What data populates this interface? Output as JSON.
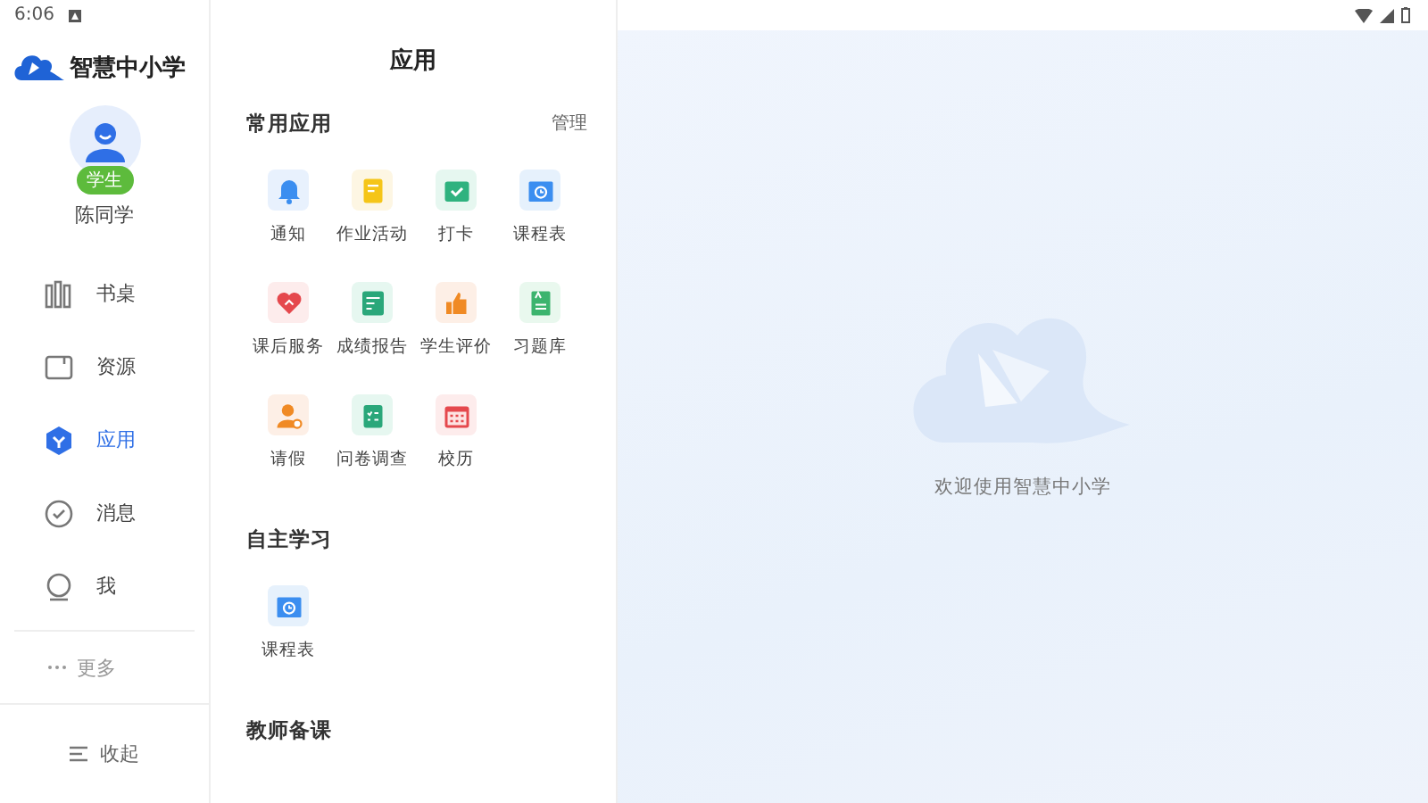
{
  "status_bar": {
    "time": "6:06"
  },
  "sidebar": {
    "logo": "智慧中小学",
    "user": {
      "role": "学生",
      "name": "陈同学"
    },
    "items": [
      {
        "kind": "desk",
        "label": "书桌",
        "selected": false
      },
      {
        "kind": "resource",
        "label": "资源",
        "selected": false
      },
      {
        "kind": "apps",
        "label": "应用",
        "selected": true
      },
      {
        "kind": "message",
        "label": "消息",
        "selected": false
      },
      {
        "kind": "me",
        "label": "我",
        "selected": false
      }
    ],
    "more": "更多",
    "collapse": "收起"
  },
  "panel": {
    "title": "应用",
    "sections": [
      {
        "title": "常用应用",
        "action": "管理",
        "apps": [
          {
            "kind": "bell",
            "label": "通知"
          },
          {
            "kind": "note",
            "label": "作业活动"
          },
          {
            "kind": "check",
            "label": "打卡"
          },
          {
            "kind": "timetable",
            "label": "课程表"
          },
          {
            "kind": "heart",
            "label": "课后服务"
          },
          {
            "kind": "score",
            "label": "成绩报告"
          },
          {
            "kind": "thumb",
            "label": "学生评价"
          },
          {
            "kind": "exercise",
            "label": "习题库"
          },
          {
            "kind": "leave",
            "label": "请假"
          },
          {
            "kind": "survey",
            "label": "问卷调查"
          },
          {
            "kind": "calendar",
            "label": "校历"
          }
        ]
      },
      {
        "title": "自主学习",
        "apps": [
          {
            "kind": "timetable",
            "label": "课程表"
          }
        ]
      },
      {
        "title": "教师备课"
      }
    ]
  },
  "welcome": {
    "text": "欢迎使用智慧中小学"
  }
}
